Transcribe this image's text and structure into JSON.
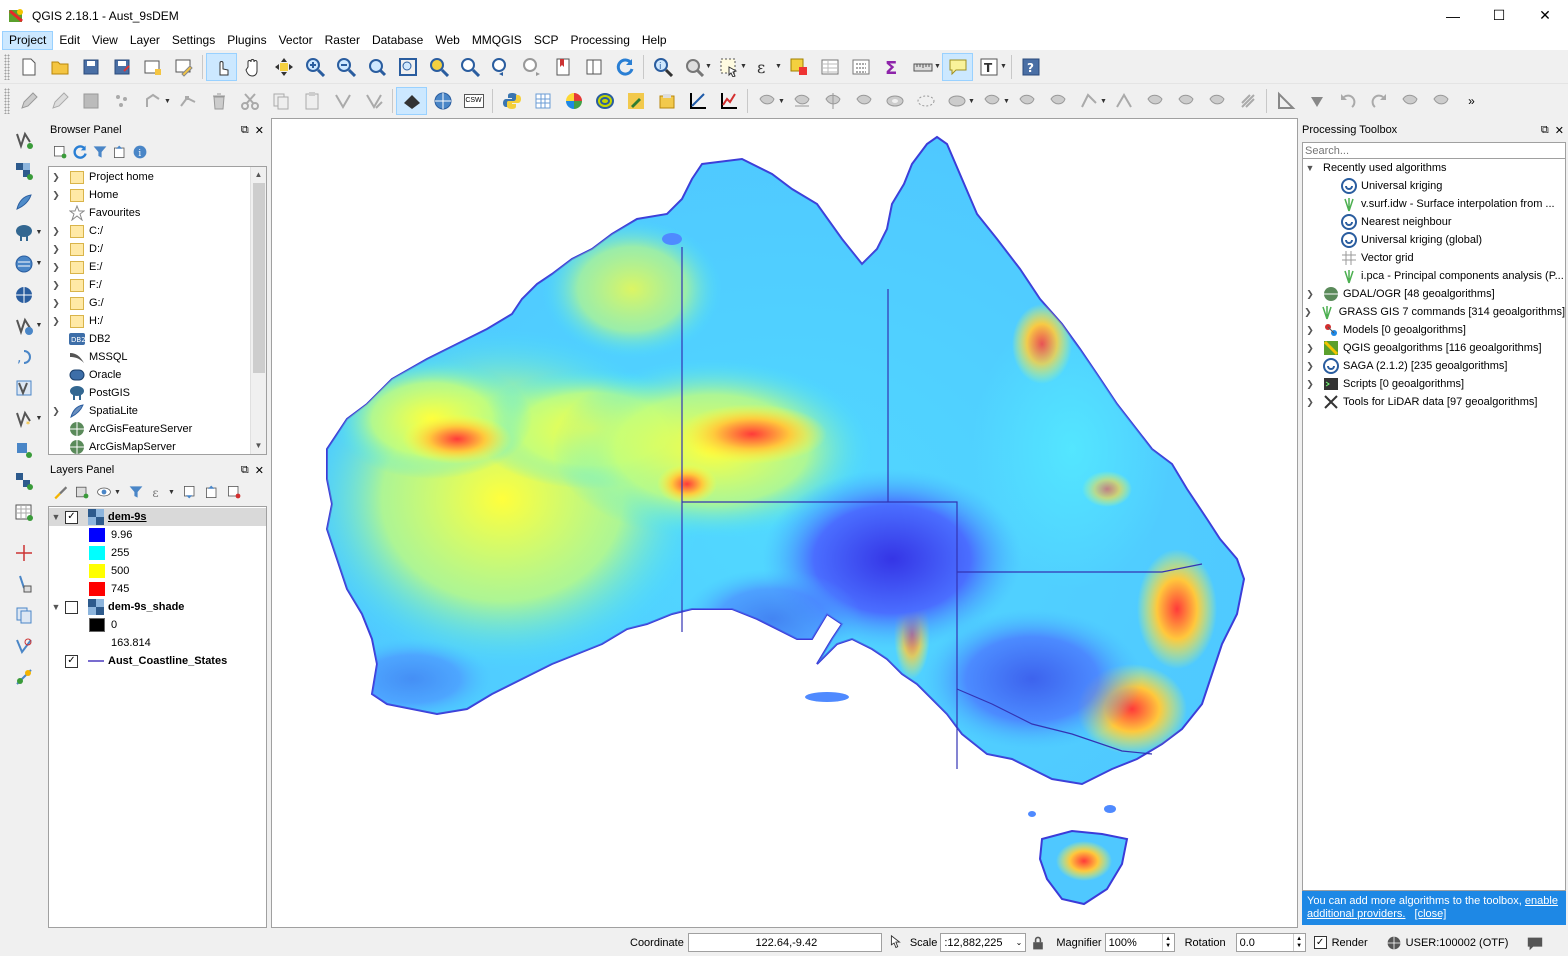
{
  "window": {
    "title": "QGIS 2.18.1 - Aust_9sDEM"
  },
  "menu": [
    "Project",
    "Edit",
    "View",
    "Layer",
    "Settings",
    "Plugins",
    "Vector",
    "Raster",
    "Database",
    "Web",
    "MMQGIS",
    "SCP",
    "Processing",
    "Help"
  ],
  "toolbar2_labels": {
    "csw": "CSW"
  },
  "browser": {
    "title": "Browser Panel",
    "items": [
      {
        "label": "Project home",
        "type": "folder"
      },
      {
        "label": "Home",
        "type": "folder"
      },
      {
        "label": "Favourites",
        "type": "star"
      },
      {
        "label": "C:/",
        "type": "folder"
      },
      {
        "label": "D:/",
        "type": "folder"
      },
      {
        "label": "E:/",
        "type": "folder"
      },
      {
        "label": "F:/",
        "type": "folder"
      },
      {
        "label": "G:/",
        "type": "folder"
      },
      {
        "label": "H:/",
        "type": "folder"
      },
      {
        "label": "DB2",
        "type": "db2"
      },
      {
        "label": "MSSQL",
        "type": "mssql"
      },
      {
        "label": "Oracle",
        "type": "oracle"
      },
      {
        "label": "PostGIS",
        "type": "postgis"
      },
      {
        "label": "SpatiaLite",
        "type": "spatialite"
      },
      {
        "label": "ArcGisFeatureServer",
        "type": "globe"
      },
      {
        "label": "ArcGisMapServer",
        "type": "globe"
      }
    ]
  },
  "layers": {
    "title": "Layers Panel",
    "dem": {
      "name": "dem-9s",
      "checked": true,
      "legend": [
        {
          "label": "9.96",
          "color": "#0000ff"
        },
        {
          "label": "255",
          "color": "#00ffff"
        },
        {
          "label": "500",
          "color": "#ffff00"
        },
        {
          "label": "745",
          "color": "#ff0000"
        }
      ]
    },
    "shade": {
      "name": "dem-9s_shade",
      "checked": false,
      "legend": [
        {
          "label": "0",
          "color": "#000000"
        },
        {
          "label": "163.814",
          "color": "#ffffff"
        }
      ]
    },
    "coast": {
      "name": "Aust_Coastline_States",
      "checked": true,
      "color": "#4b3bbf"
    }
  },
  "processing": {
    "title": "Processing Toolbox",
    "search_placeholder": "Search...",
    "recent_label": "Recently used algorithms",
    "recent": [
      "Universal kriging",
      "v.surf.idw - Surface interpolation from ...",
      "Nearest neighbour",
      "Universal kriging (global)",
      "Vector grid",
      "i.pca - Principal components analysis (P..."
    ],
    "providers": [
      "GDAL/OGR [48 geoalgorithms]",
      "GRASS GIS 7 commands [314 geoalgorithms]",
      "Models [0 geoalgorithms]",
      "QGIS geoalgorithms [116 geoalgorithms]",
      "SAGA (2.1.2) [235 geoalgorithms]",
      "Scripts [0 geoalgorithms]",
      "Tools for LiDAR data [97 geoalgorithms]"
    ],
    "info_text": "You can add more algorithms to the toolbox, ",
    "info_link": "enable additional providers.",
    "info_close": "[close]"
  },
  "status": {
    "coordinate_label": "Coordinate",
    "coordinate_value": "122.64,-9.42",
    "scale_label": "Scale",
    "scale_value": ":12,882,225",
    "magnifier_label": "Magnifier",
    "magnifier_value": "100%",
    "rotation_label": "Rotation",
    "rotation_value": "0.0",
    "render_label": "Render",
    "render_checked": true,
    "crs_label": "USER:100002 (OTF)"
  }
}
